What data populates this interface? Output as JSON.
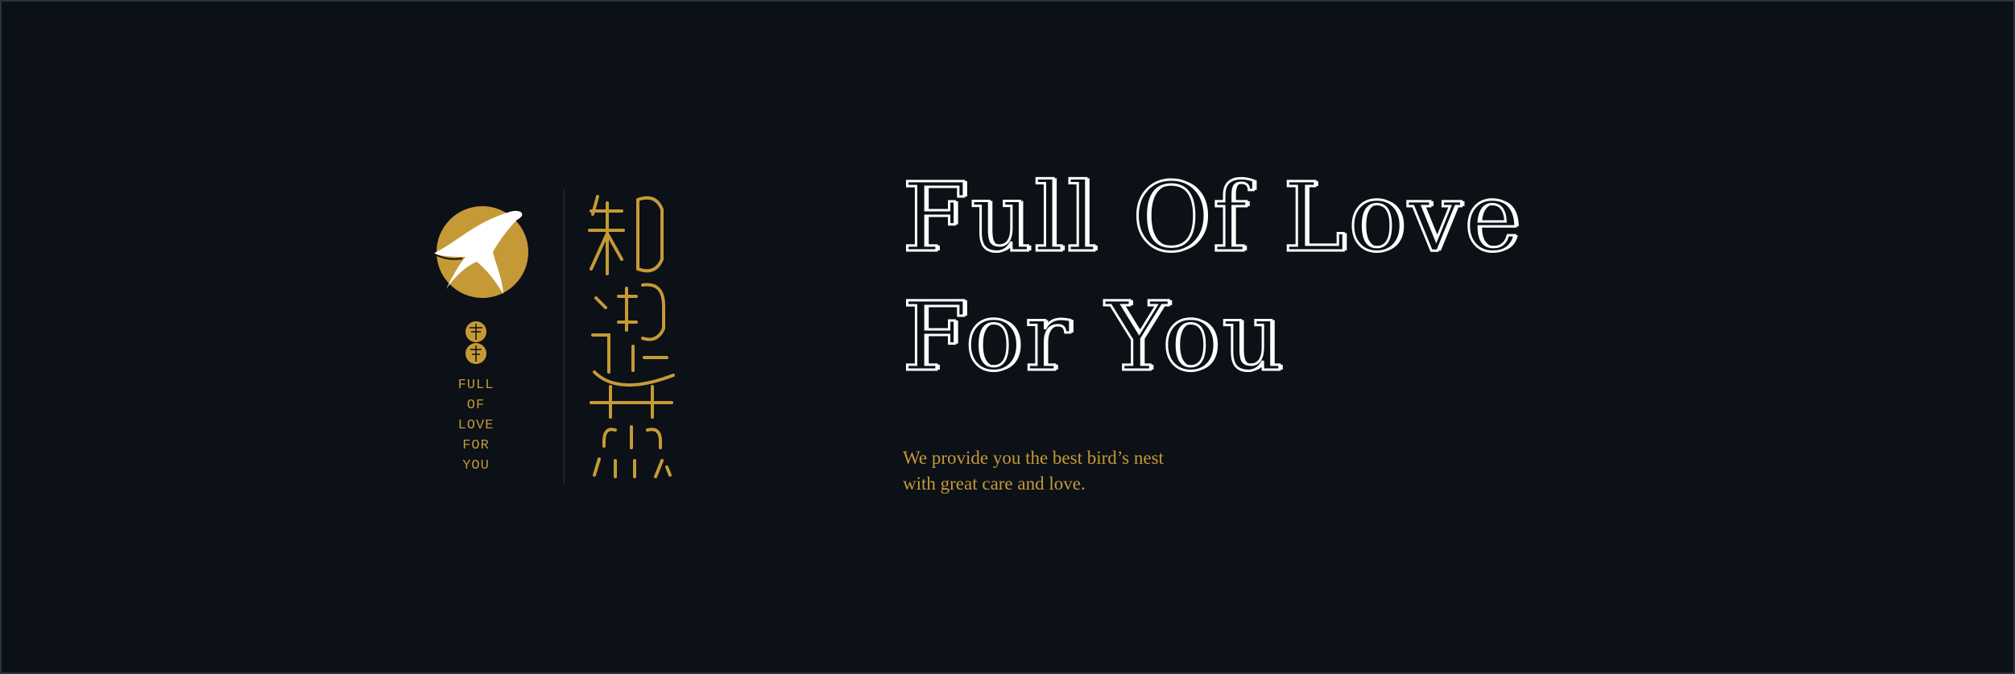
{
  "brand": {
    "name_cjk": "知遇燕",
    "tagline_lines": [
      "FULL",
      "OF",
      "LOVE",
      "FOR",
      "YOU"
    ]
  },
  "hero": {
    "headline_lines": [
      "Full Of Love",
      "For You"
    ],
    "subtext_lines": [
      "We provide you the best bird’s nest",
      "with great care and love."
    ]
  },
  "colors": {
    "background": "#0c1017",
    "gold": "#c59a36",
    "white": "#ffffff"
  },
  "icons": [
    "swallow-icon",
    "seal-icon"
  ]
}
